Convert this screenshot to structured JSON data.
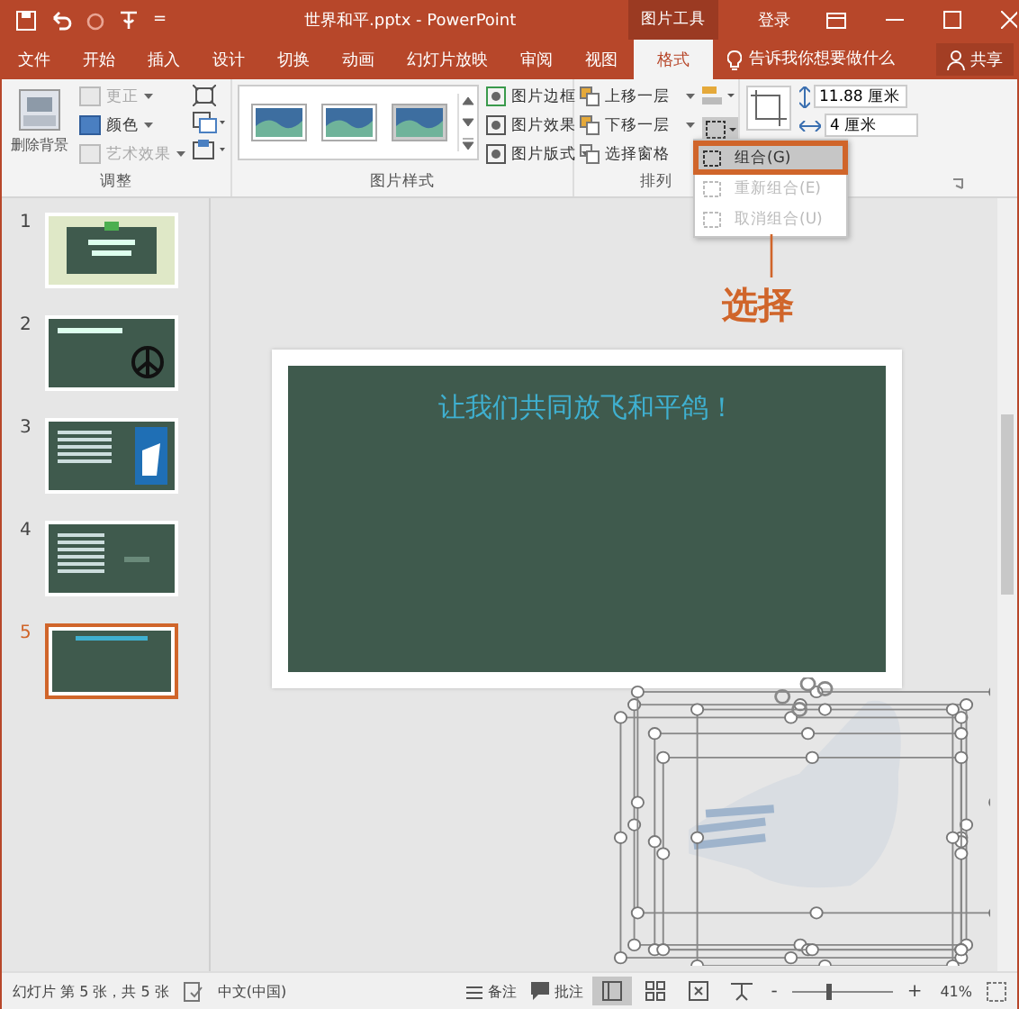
{
  "title_bar": {
    "qat_more": "=",
    "title": "世界和平.pptx - PowerPoint",
    "context_label": "图片工具",
    "sign_in": "登录"
  },
  "tabs": [
    {
      "label": "文件",
      "selected": false
    },
    {
      "label": "开始",
      "selected": false
    },
    {
      "label": "插入",
      "selected": false
    },
    {
      "label": "设计",
      "selected": false
    },
    {
      "label": "切换",
      "selected": false
    },
    {
      "label": "动画",
      "selected": false
    },
    {
      "label": "幻灯片放映",
      "selected": false
    },
    {
      "label": "审阅",
      "selected": false
    },
    {
      "label": "视图",
      "selected": false
    },
    {
      "label": "格式",
      "selected": true
    }
  ],
  "tell_me": {
    "placeholder": "告诉我你想要做什么"
  },
  "share": "共享",
  "ribbon": {
    "adjust": {
      "label": "调整",
      "big_button": "删除背景",
      "items": [
        {
          "label": "更正",
          "disabled": true
        },
        {
          "label": "颜色",
          "disabled": false
        },
        {
          "label": "艺术效果",
          "disabled": true
        }
      ]
    },
    "styles": {
      "label": "图片样式",
      "items": [
        "图片边框",
        "图片效果",
        "图片版式"
      ]
    },
    "arrange": {
      "label": "排列",
      "items": [
        "上移一层",
        "下移一层",
        "选择窗格"
      ]
    },
    "size": {
      "height": "11.88 厘米",
      "width": "4 厘米"
    }
  },
  "group_menu": {
    "items": [
      {
        "label": "组合(G)",
        "disabled": false,
        "selected": true
      },
      {
        "label": "重新组合(E)",
        "disabled": true,
        "selected": false
      },
      {
        "label": "取消组合(U)",
        "disabled": true,
        "selected": false
      }
    ]
  },
  "callout": "选择",
  "slides": [
    {
      "number": "1",
      "kind": "title",
      "selected": false
    },
    {
      "number": "2",
      "kind": "peace",
      "selected": false
    },
    {
      "number": "3",
      "kind": "hand",
      "selected": false
    },
    {
      "number": "4",
      "kind": "text",
      "selected": false
    },
    {
      "number": "5",
      "kind": "heading",
      "selected": true
    }
  ],
  "slide": {
    "title": "让我们共同放飞和平鸽！"
  },
  "status_bar": {
    "slide_info": "幻灯片 第 5 张，共 5 张",
    "language": "中文(中国)",
    "notes": "备注",
    "comments": "批注",
    "views": [
      {
        "selected": true
      },
      {
        "selected": false
      },
      {
        "selected": false
      },
      {
        "selected": false
      }
    ],
    "zoom_slider": {
      "level": 0.35
    },
    "zoom_out": "-",
    "zoom_in": "+",
    "zoom": "41%"
  }
}
